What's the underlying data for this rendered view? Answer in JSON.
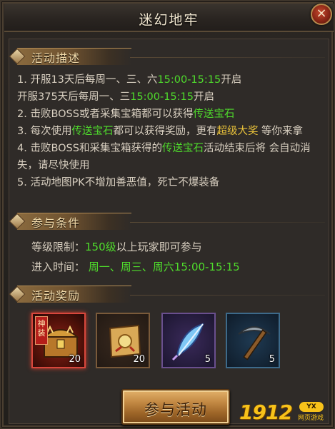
{
  "window": {
    "title": "迷幻地牢",
    "close_label": "×"
  },
  "description": {
    "header": "活动描述",
    "items": [
      {
        "parts": [
          {
            "t": "1.  开服13天后每周一、三、六"
          },
          {
            "t": "15:00-15:15",
            "c": "green"
          },
          {
            "t": "开启"
          }
        ]
      },
      {
        "parts": [
          {
            "t": "     开服375天后每周一、三"
          },
          {
            "t": "15:00-15:15",
            "c": "green"
          },
          {
            "t": "开启"
          }
        ]
      },
      {
        "parts": [
          {
            "t": "2.  击败BOSS或者采集宝箱都可以获得"
          },
          {
            "t": "传送宝石",
            "c": "green"
          }
        ]
      },
      {
        "parts": [
          {
            "t": "3.  每次使用"
          },
          {
            "t": "传送宝石",
            "c": "green"
          },
          {
            "t": "都可以获得奖励，更有"
          },
          {
            "t": "超级大奖",
            "c": "yellow"
          },
          {
            "t": "    等你来拿"
          }
        ]
      },
      {
        "parts": [
          {
            "t": "4.  击败BOSS和采集宝箱获得的"
          },
          {
            "t": "传送宝石",
            "c": "green"
          },
          {
            "t": "活动结束后将    会自动消失，请尽快使用"
          }
        ]
      },
      {
        "parts": [
          {
            "t": "5.  活动地图PK不增加善恶值，死亡不爆装备"
          }
        ]
      }
    ]
  },
  "conditions": {
    "header": "参与条件",
    "level_label": "等级限制：",
    "level_value": "150级",
    "level_suffix": "以上玩家即可参与",
    "time_label": "进入时间：",
    "time_value": "周一、周三、周六15:00-15:15"
  },
  "rewards": {
    "header": "活动奖励",
    "items": [
      {
        "name": "chest-item",
        "ribbon": "神装",
        "qty": "20"
      },
      {
        "name": "scroll-item",
        "qty": "20"
      },
      {
        "name": "feather-item",
        "qty": "5"
      },
      {
        "name": "pickaxe-item",
        "qty": "5"
      }
    ]
  },
  "join_button": "参与活动",
  "watermark": {
    "num": "1912",
    "tag": "YX",
    "sub": "网页游戏"
  },
  "colors": {
    "green": "#4fdc2c",
    "yellow": "#e9c23a"
  }
}
